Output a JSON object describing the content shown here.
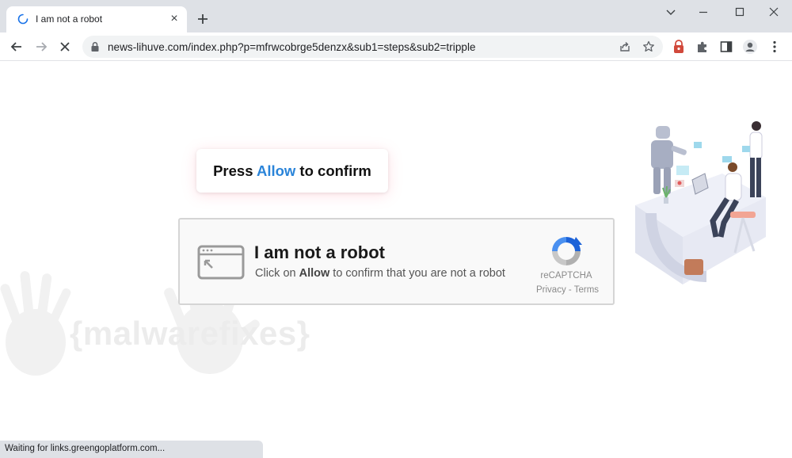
{
  "tab": {
    "title": "I am not a robot",
    "close_glyph": "×",
    "icons": [
      "loading-spinner-icon",
      "close-icon",
      "plus-icon"
    ]
  },
  "window_controls": {
    "icons": [
      "chevron-down-icon",
      "minimize-icon",
      "maximize-icon",
      "close-icon"
    ]
  },
  "toolbar": {
    "url": "news-lihuve.com/index.php?p=mfrwcobrge5denzx&sub1=steps&sub2=tripple",
    "icons": [
      "back-arrow-icon",
      "forward-arrow-icon",
      "stop-loading-icon",
      "lock-icon",
      "share-icon",
      "star-icon",
      "extension-badge-icon",
      "puzzle-icon",
      "side-panel-icon",
      "profile-icon",
      "kebab-menu-icon"
    ]
  },
  "page": {
    "press": {
      "before": "Press ",
      "allow": "Allow",
      "after": " to confirm"
    },
    "captcha": {
      "title": "I am not a robot",
      "sub_before": "Click on ",
      "sub_bold": "Allow",
      "sub_after": " to confirm that you are not a robot",
      "brand": "reCAPTCHA",
      "links": "Privacy - Terms",
      "icons": [
        "browser-window-icon",
        "recaptcha-logo-icon"
      ]
    },
    "watermark": "{malwarefixes}",
    "illustration": "robot-office-illustration"
  },
  "status": {
    "text": "Waiting for links.greengoplatform.com..."
  },
  "colors": {
    "tabbar": "#dee1e6",
    "allow_blue": "#2a84d9",
    "captcha_bg": "#f9f9f9",
    "recaptcha_blue": "#1c62d8",
    "recaptcha_gray": "#b0b0b0"
  }
}
